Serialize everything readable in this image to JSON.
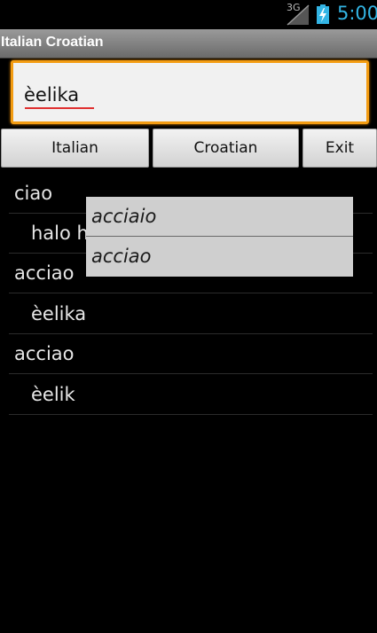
{
  "status_bar": {
    "network": "3G",
    "time": "5:00",
    "colors": {
      "clock": "#33b5e5"
    }
  },
  "app": {
    "title": "Italian Croatian"
  },
  "search": {
    "value": "èelika"
  },
  "buttons": {
    "italian": "Italian",
    "croatian": "Croatian",
    "exit": "Exit"
  },
  "results": [
    {
      "text": "ciao",
      "kind": "term"
    },
    {
      "text": "halo h",
      "kind": "translation"
    },
    {
      "text": "acciao",
      "kind": "term"
    },
    {
      "text": "èelika",
      "kind": "translation"
    },
    {
      "text": "acciao",
      "kind": "term"
    },
    {
      "text": "èelik",
      "kind": "translation"
    }
  ],
  "suggestions": [
    "acciaio",
    "acciao"
  ],
  "colors": {
    "input_border": "#f39c12",
    "spellcheck_underline": "#e03030"
  }
}
